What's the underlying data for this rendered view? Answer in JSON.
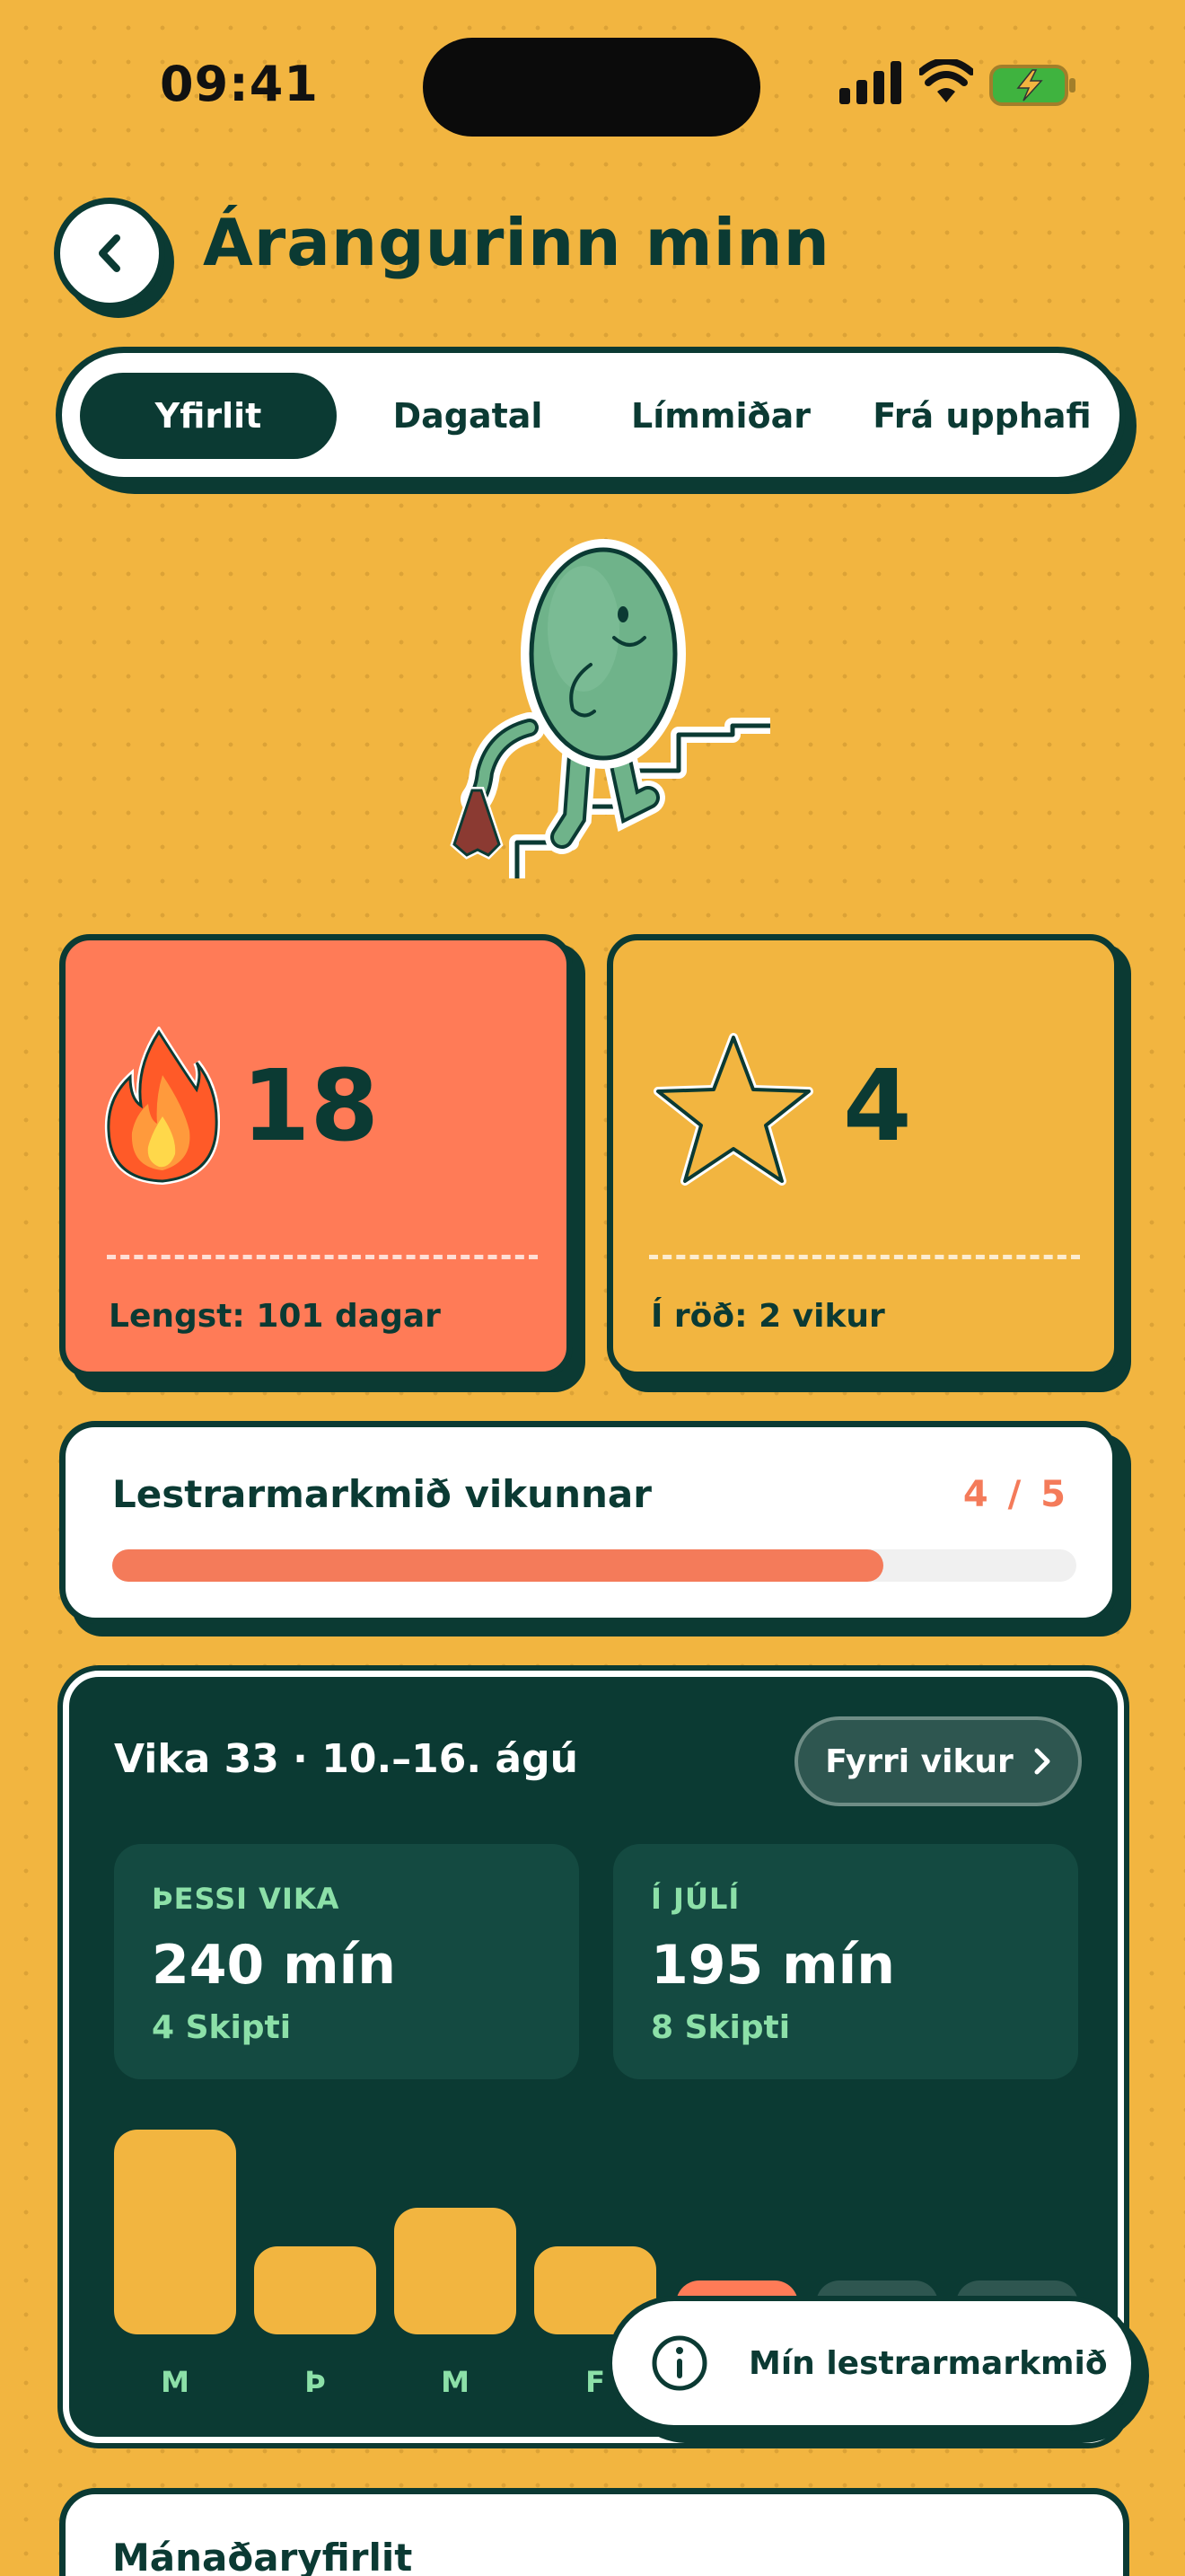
{
  "status_bar": {
    "time": "09:41"
  },
  "header": {
    "title": "Árangurinn minn"
  },
  "tabs": [
    {
      "label": "Yfirlit",
      "active": true
    },
    {
      "label": "Dagatal",
      "active": false
    },
    {
      "label": "Límmiðar",
      "active": false
    },
    {
      "label": "Frá upphafi",
      "active": false
    }
  ],
  "streak_card": {
    "value": "18",
    "subtitle": "Lengst: 101 dagar",
    "icon": "fire-icon",
    "color": "#FF7B57"
  },
  "star_card": {
    "value": "4",
    "subtitle": "Í röð: 2 vikur",
    "icon": "star-icon",
    "color": "#F2B540"
  },
  "goal": {
    "title": "Lestrarmarkmið vikunnar",
    "count": "4 / 5",
    "progress": 0.8
  },
  "week": {
    "title": "Vika 33 · 10.–16. ágú",
    "prev_label": "Fyrri vikur",
    "this_week": {
      "label": "ÞESSI VIKA",
      "value": "240 mín",
      "sessions": "4 Skipti"
    },
    "july": {
      "label": "Í JÚLÍ",
      "value": "195 mín",
      "sessions": "8 Skipti"
    },
    "days": [
      "M",
      "Þ",
      "M",
      "F"
    ],
    "bar_heights": [
      1.0,
      0.43,
      0.62,
      0.43
    ],
    "bar_color": "#F2B540"
  },
  "floating": {
    "label": "Mín lestrarmarkmið",
    "icon": "info-icon"
  },
  "monthly": {
    "title": "Mánaðaryfirlit"
  }
}
